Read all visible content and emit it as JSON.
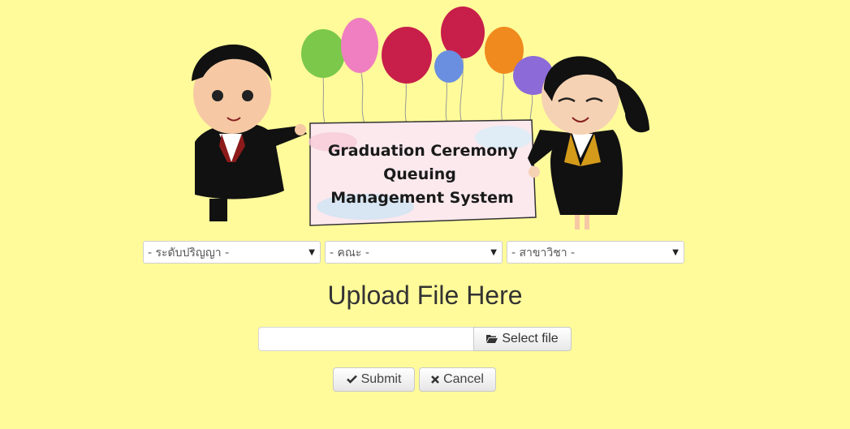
{
  "banner": {
    "title_line1": "Graduation Ceremony",
    "title_line2": "Queuing",
    "title_line3": "Management System"
  },
  "filters": {
    "degree_level": "- ระดับปริญญา -",
    "faculty": "- คณะ -",
    "major": "- สาขาวิชา -",
    "arrow": "▼"
  },
  "upload": {
    "title": "Upload File Here",
    "file_value": "",
    "select_file_label": "Select file"
  },
  "actions": {
    "submit_label": "Submit",
    "cancel_label": "Cancel"
  },
  "icons": {
    "folder": "folder-open-icon",
    "check": "check-icon",
    "close": "close-icon"
  },
  "colors": {
    "background": "#fffb9a",
    "balloon_green": "#7cc84a",
    "balloon_pink": "#ef7fc0",
    "balloon_red": "#c81e4a",
    "balloon_blue": "#6a8fe0",
    "balloon_orange": "#f08a1e",
    "balloon_purple": "#8c6ad8"
  }
}
